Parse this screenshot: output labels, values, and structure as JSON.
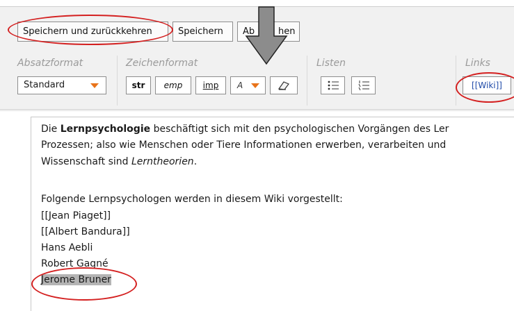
{
  "toolbar": {
    "save_return_label": "Speichern und zurückkehren",
    "save_label": "Speichern",
    "cancel_label_left": "Ab",
    "cancel_label_right": "hen"
  },
  "groups": {
    "paragraph": "Absatzformat",
    "character": "Zeichenformat",
    "lists": "Listen",
    "links": "Links"
  },
  "paragraph_select": {
    "value": "Standard"
  },
  "character_buttons": {
    "strong": "str",
    "emphasis": "emp",
    "important": "imp",
    "color": "A"
  },
  "link_button": "[[Wiki]]",
  "colors": {
    "accent": "#e8731a",
    "annotation": "#d42020",
    "arrow": "#8c8c8c"
  },
  "editor": {
    "p1_prefix": "Die ",
    "p1_bold": "Lernpsychologie",
    "p1_suffix": " beschäftigt sich mit den psychologischen Vorgängen des Ler",
    "p1_line2": "Prozessen; also wie Menschen oder Tiere Informationen erwerben, verarbeiten und",
    "p1_line3_prefix": "Wissenschaft sind ",
    "p1_line3_italic": "Lerntheorien",
    "p1_line3_suffix": ".",
    "intro": "Folgende Lernpsychologen werden in diesem Wiki vorgestellt:",
    "names": [
      "[[Jean Piaget]]",
      "[[Albert Bandura]]",
      "Hans Aebli",
      "Robert Gagné",
      "Jerome Bruner"
    ]
  }
}
